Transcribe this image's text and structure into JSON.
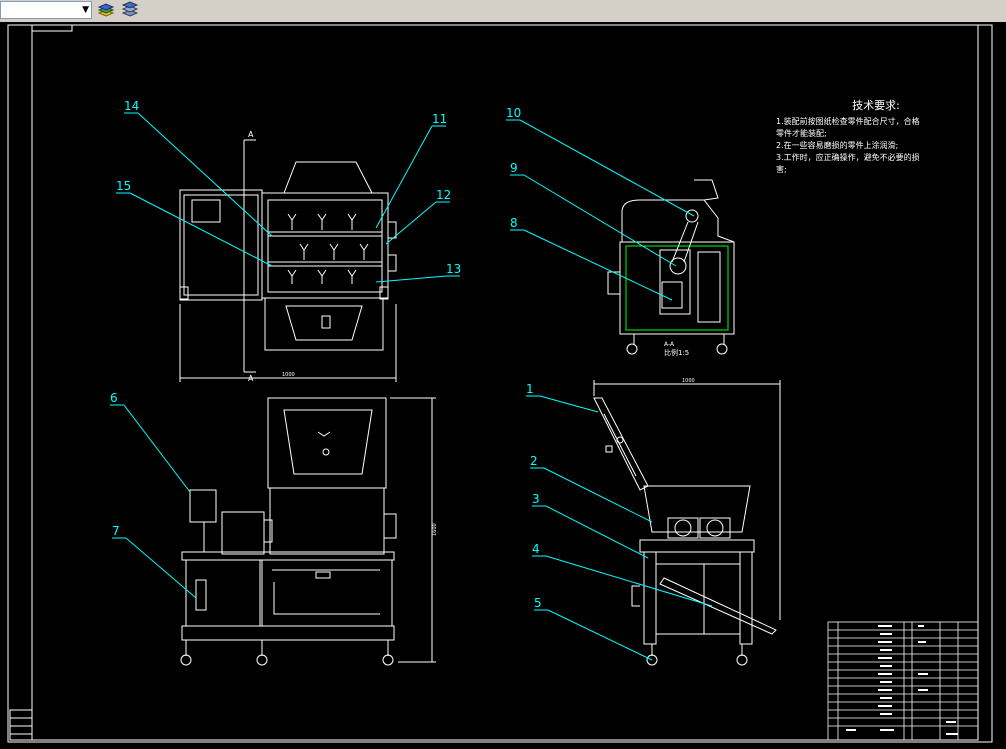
{
  "toolbar": {
    "layer_value": "",
    "icons": [
      "layer-properties-icon",
      "layer-stack-icon"
    ]
  },
  "drawing": {
    "balloons": [
      "1",
      "2",
      "3",
      "4",
      "5",
      "6",
      "7",
      "8",
      "9",
      "10",
      "11",
      "12",
      "13",
      "14",
      "15"
    ],
    "section_labels": [
      "A",
      "A"
    ],
    "section_view_label": "A-A",
    "scale_label": "比例1:5",
    "dim_top_width": "1000",
    "dim_side_width": "1000",
    "dim_front_height": "1600"
  },
  "tech_requirements": {
    "title": "技术要求:",
    "lines": [
      "1.装配前按图纸检查零件配合尺寸，合格",
      "零件才能装配;",
      "2.在一些容易磨损的零件上涂润滑;",
      "3.工作时，应正确操作，避免不必要的损",
      "害;"
    ]
  },
  "colors": {
    "line": "#ffffff",
    "leader": "#00ffff",
    "accent": "#00ff00",
    "bg": "#000000"
  }
}
